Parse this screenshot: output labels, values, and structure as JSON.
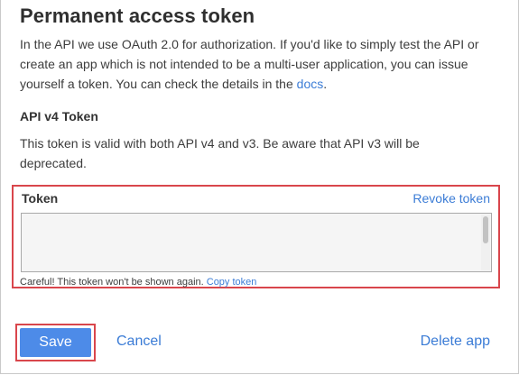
{
  "dialog": {
    "title": "Permanent access token",
    "intro_text": "In the API we use OAuth 2.0 for authorization. If you'd like to simply test the API or create an app which is not intended to be a multi-user application, you can issue yourself a token. You can check the details in the ",
    "intro_link": "docs",
    "intro_end": "."
  },
  "api_token": {
    "heading": "API v4 Token",
    "description": "This token is valid with both API v4 and v3. Be aware that API v3 will be deprecated."
  },
  "token_box": {
    "label": "Token",
    "revoke_label": "Revoke token",
    "value": "",
    "warning_text": "Careful! This token won't be shown again. ",
    "copy_label": "Copy token"
  },
  "footer": {
    "save_label": "Save",
    "cancel_label": "Cancel",
    "delete_label": "Delete app"
  },
  "colors": {
    "accent": "#4d8be8",
    "link": "#3b7cd6",
    "highlight_border": "#d9464c"
  }
}
